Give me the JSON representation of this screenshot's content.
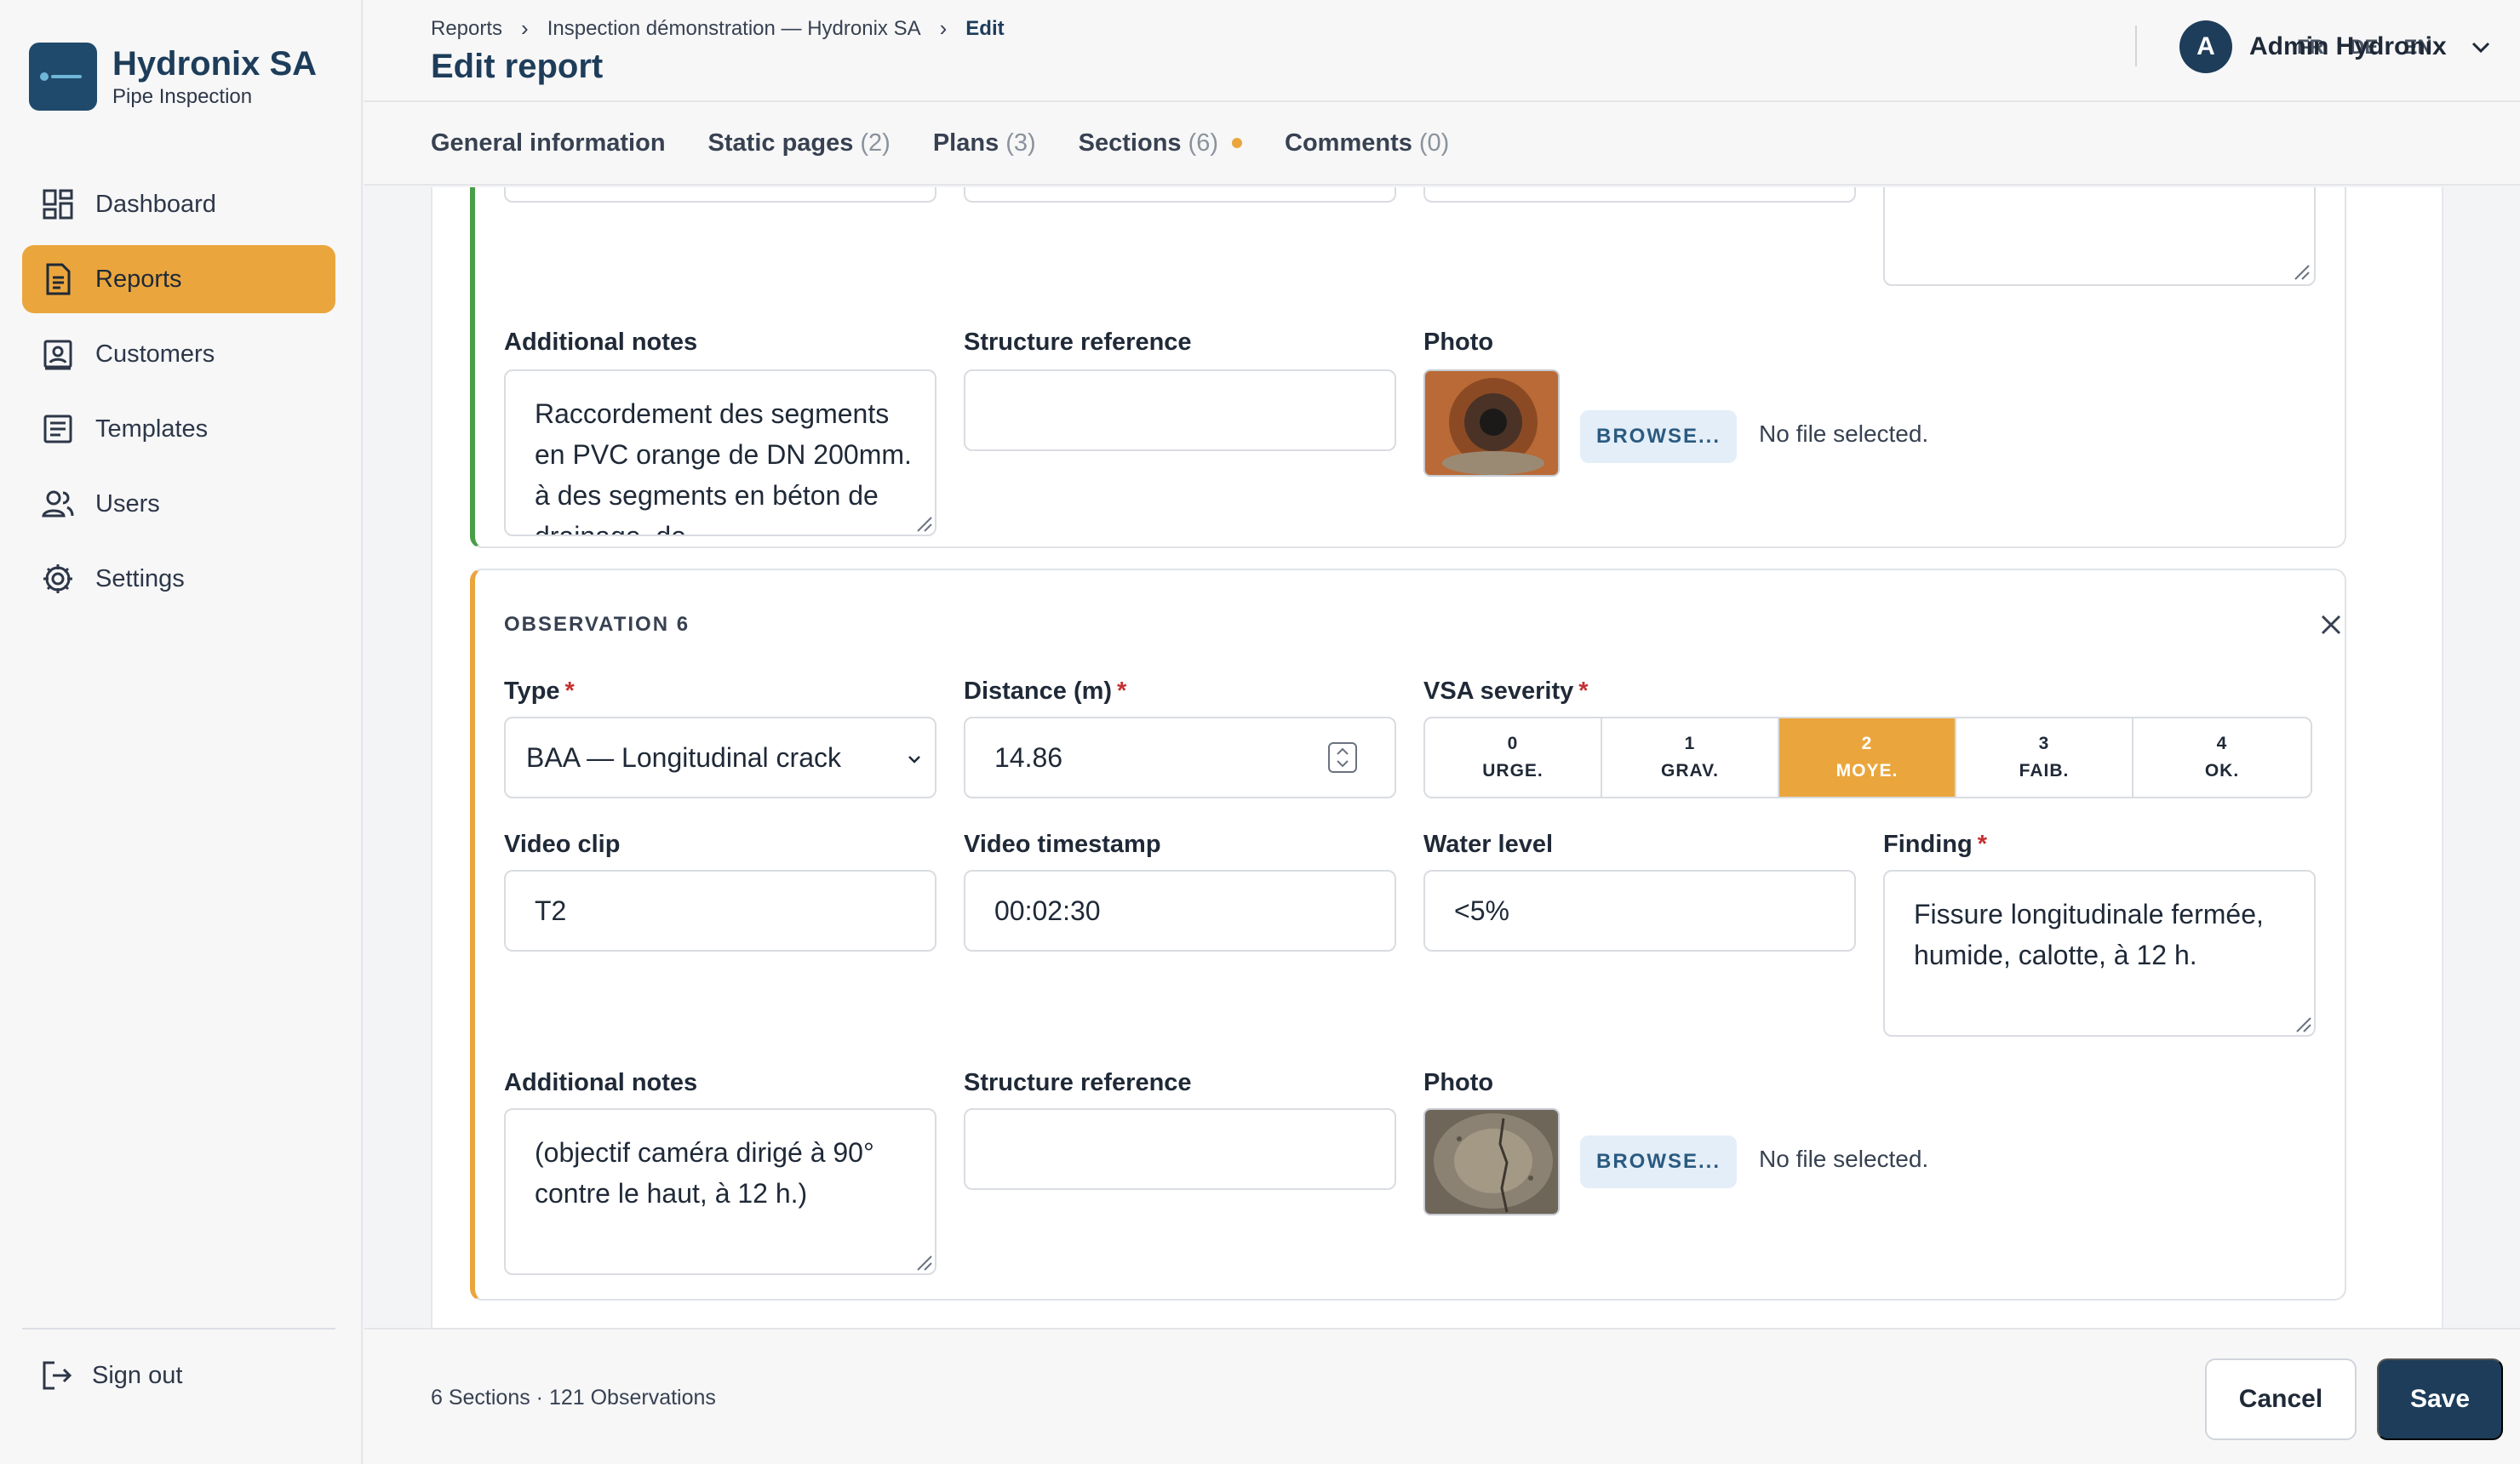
{
  "brand": {
    "name": "Hydronix SA",
    "subtitle": "Pipe Inspection"
  },
  "nav": {
    "items": [
      {
        "label": "Dashboard",
        "icon": "dashboard-icon"
      },
      {
        "label": "Reports",
        "icon": "document-icon",
        "active": true
      },
      {
        "label": "Customers",
        "icon": "contact-card-icon"
      },
      {
        "label": "Templates",
        "icon": "template-icon"
      },
      {
        "label": "Users",
        "icon": "users-icon"
      },
      {
        "label": "Settings",
        "icon": "gear-icon"
      }
    ],
    "signout": "Sign out"
  },
  "header": {
    "breadcrumb": [
      "Reports",
      "Inspection démonstration — Hydronix SA",
      "Edit"
    ],
    "title": "Edit report",
    "languages": [
      "FR",
      "DE",
      "EN"
    ],
    "user": {
      "initial": "A",
      "name": "Admin Hydronix"
    }
  },
  "tabs": [
    {
      "label": "General information",
      "count": ""
    },
    {
      "label": "Static pages",
      "count": "(2)"
    },
    {
      "label": "Plans",
      "count": "(3)"
    },
    {
      "label": "Sections",
      "count": "(6)",
      "dot": true
    },
    {
      "label": "Comments",
      "count": "(0)"
    }
  ],
  "obs5": {
    "notes_label": "Additional notes",
    "notes": "Raccordement des segments en PVC orange de DN 200mm. à des segments en béton de drainage, de",
    "structure_label": "Structure reference",
    "structure": "",
    "photo_label": "Photo",
    "browse": "BROWSE...",
    "nofile": "No file selected."
  },
  "obs6": {
    "title": "OBSERVATION 6",
    "type_label": "Type",
    "type": "BAA — Longitudinal crack",
    "distance_label": "Distance (m)",
    "distance": "14.86",
    "severity_label": "VSA severity",
    "severity": [
      {
        "n": "0",
        "label": "URGE."
      },
      {
        "n": "1",
        "label": "GRAV."
      },
      {
        "n": "2",
        "label": "MOYE.",
        "active": true
      },
      {
        "n": "3",
        "label": "FAIB."
      },
      {
        "n": "4",
        "label": "OK."
      }
    ],
    "clip_label": "Video clip",
    "clip": "T2",
    "timestamp_label": "Video timestamp",
    "timestamp": "00:02:30",
    "water_label": "Water level",
    "water": "<5%",
    "finding_label": "Finding",
    "finding": "Fissure longitudinale fermée, humide, calotte, à 12 h.",
    "notes_label": "Additional notes",
    "notes": "(objectif caméra dirigé à 90° contre le haut, à 12 h.)",
    "structure_label": "Structure reference",
    "structure": "",
    "photo_label": "Photo",
    "browse": "BROWSE...",
    "nofile": "No file selected."
  },
  "footer": {
    "summary": "6 Sections · 121 Observations",
    "cancel": "Cancel",
    "save": "Save"
  },
  "colors": {
    "accent": "#eaa63d",
    "primary": "#1d3d5a",
    "green": "#4a9e47"
  }
}
